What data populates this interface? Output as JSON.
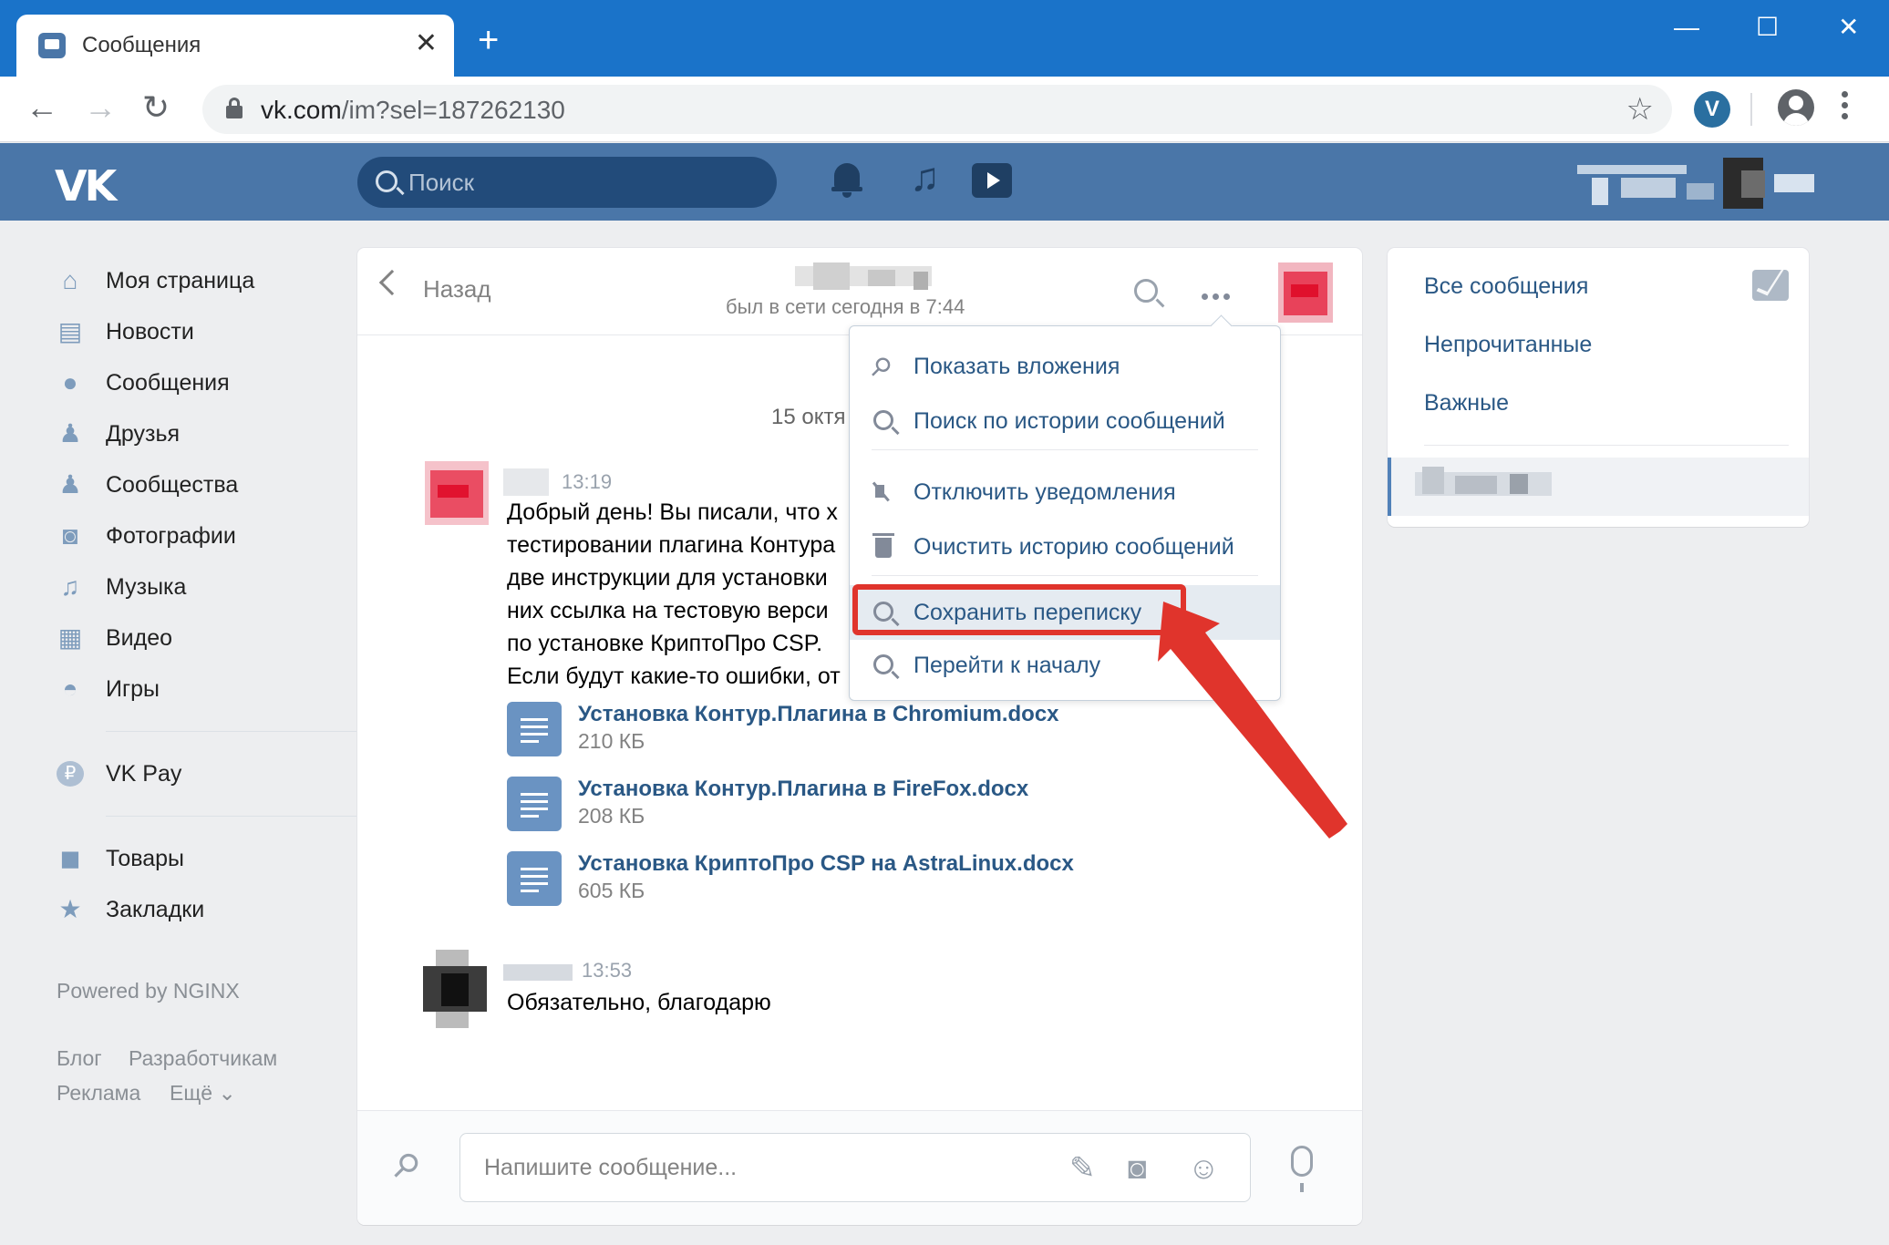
{
  "browser": {
    "tab_title": "Сообщения",
    "tab_close": "✕",
    "new_tab": "+",
    "url_host": "vk.com",
    "url_path": "/im?sel=187262130",
    "back": "←",
    "forward": "→",
    "reload": "↻",
    "star": "☆",
    "minimize": "—",
    "maximize": "☐",
    "close": "✕",
    "extension_glyph": "V"
  },
  "vk_header": {
    "logo": "VK",
    "search_placeholder": "Поиск"
  },
  "left_nav": {
    "items": [
      {
        "label": "Моя страница",
        "icon": "home-icon",
        "glyph": "⌂"
      },
      {
        "label": "Новости",
        "icon": "news-icon",
        "glyph": "▤"
      },
      {
        "label": "Сообщения",
        "icon": "messages-icon",
        "glyph": "●"
      },
      {
        "label": "Друзья",
        "icon": "friend-icon",
        "glyph": "♟"
      },
      {
        "label": "Сообщества",
        "icon": "groups-icon",
        "glyph": "♟"
      },
      {
        "label": "Фотографии",
        "icon": "camera-icon",
        "glyph": "◙"
      },
      {
        "label": "Музыка",
        "icon": "music-icon",
        "glyph": "♫"
      },
      {
        "label": "Видео",
        "icon": "film-icon",
        "glyph": "▦"
      },
      {
        "label": "Игры",
        "icon": "gamepad-icon",
        "glyph": "◓"
      }
    ],
    "vkpay": {
      "label": "VK Pay",
      "icon": "vkpay-icon",
      "glyph": "₽"
    },
    "extra": [
      {
        "label": "Товары",
        "icon": "bag-icon",
        "glyph": "◼"
      },
      {
        "label": "Закладки",
        "icon": "star-icon",
        "glyph": "★"
      }
    ],
    "powered": "Powered by NGINX",
    "footer_links": [
      "Блог",
      "Разработчикам",
      "Реклама",
      "Ещё ⌄"
    ]
  },
  "chat": {
    "back_label": "Назад",
    "online_status": "был в сети сегодня в 7:44",
    "date_divider": "15 октя",
    "messages": [
      {
        "time": "13:19",
        "lines": [
          "Добрый день! Вы писали, что х",
          "тестировании плагина Контура",
          "две инструкции для установки",
          "них ссылка на тестовую верси",
          "по установке КриптоПро CSP.",
          "Если будут какие-то ошибки, от"
        ],
        "attachments": [
          {
            "name": "Установка Контур.Плагина в Chromium.docx",
            "size": "210 КБ"
          },
          {
            "name": "Установка Контур.Плагина в FireFox.docx",
            "size": "208 КБ"
          },
          {
            "name": "Установка КриптоПро CSP на AstraLinux.docx",
            "size": "605 КБ"
          }
        ]
      },
      {
        "time": "13:53",
        "lines": [
          "Обязательно, благодарю"
        ]
      }
    ],
    "composer_placeholder": "Напишите сообщение..."
  },
  "dropdown": {
    "items": [
      {
        "label": "Показать вложения",
        "icon": "paperclip-icon"
      },
      {
        "label": "Поиск по истории сообщений",
        "icon": "search-icon"
      },
      {
        "label": "Отключить уведомления",
        "icon": "mute-icon"
      },
      {
        "label": "Очистить историю сообщений",
        "icon": "trash-icon"
      },
      {
        "label": "Сохранить переписку",
        "icon": "search-icon",
        "highlighted": true
      },
      {
        "label": "Перейти к началу",
        "icon": "search-icon"
      }
    ]
  },
  "right_panel": {
    "items": [
      "Все сообщения",
      "Непрочитанные",
      "Важные"
    ]
  },
  "colors": {
    "vk_blue": "#4a76a8",
    "link": "#2a5885",
    "annotation_red": "#e0342c",
    "browser_chrome": "#1a73c9"
  }
}
